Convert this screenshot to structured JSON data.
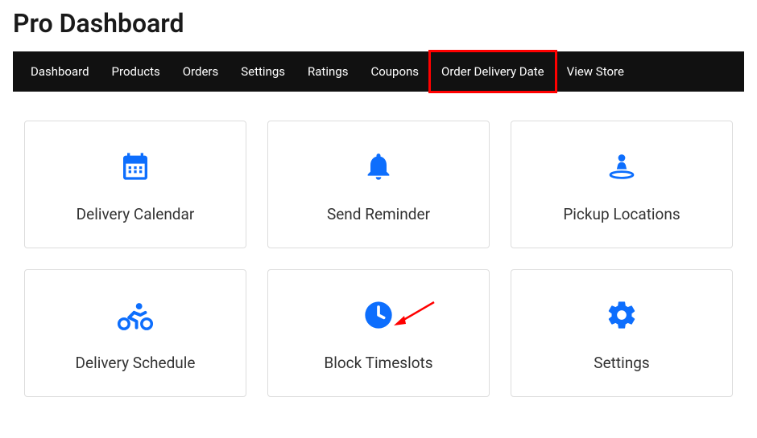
{
  "page_title": "Pro Dashboard",
  "nav": {
    "items": [
      {
        "label": "Dashboard",
        "highlighted": false
      },
      {
        "label": "Products",
        "highlighted": false
      },
      {
        "label": "Orders",
        "highlighted": false
      },
      {
        "label": "Settings",
        "highlighted": false
      },
      {
        "label": "Ratings",
        "highlighted": false
      },
      {
        "label": "Coupons",
        "highlighted": false
      },
      {
        "label": "Order Delivery Date",
        "highlighted": true
      },
      {
        "label": "View Store",
        "highlighted": false
      }
    ]
  },
  "cards": [
    {
      "icon": "calendar",
      "label": "Delivery Calendar"
    },
    {
      "icon": "bell",
      "label": "Send Reminder"
    },
    {
      "icon": "person-pin",
      "label": "Pickup Locations"
    },
    {
      "icon": "cyclist",
      "label": "Delivery Schedule"
    },
    {
      "icon": "clock",
      "label": "Block Timeslots",
      "annotation": "arrow"
    },
    {
      "icon": "gear",
      "label": "Settings"
    }
  ]
}
